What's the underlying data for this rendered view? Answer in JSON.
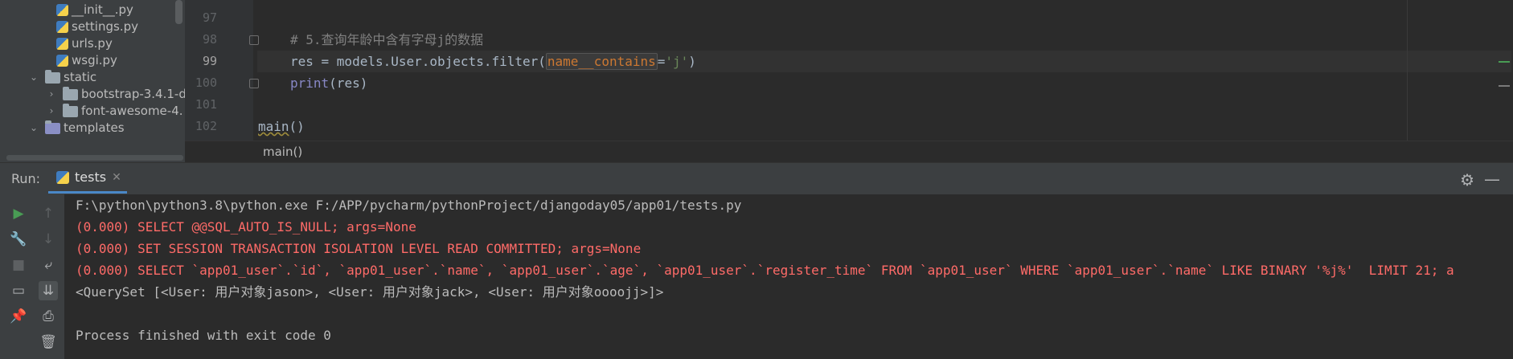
{
  "project_tree": {
    "items": [
      {
        "label": "__init__.py",
        "type": "python-file"
      },
      {
        "label": "settings.py",
        "type": "python-file"
      },
      {
        "label": "urls.py",
        "type": "python-file"
      },
      {
        "label": "wsgi.py",
        "type": "python-file"
      },
      {
        "label": "static",
        "type": "folder-expanded"
      },
      {
        "label": "bootstrap-3.4.1-d",
        "type": "folder-collapsed"
      },
      {
        "label": "font-awesome-4.",
        "type": "folder-collapsed"
      },
      {
        "label": "templates",
        "type": "folder-expanded"
      }
    ]
  },
  "editor": {
    "line_numbers": [
      "97",
      "98",
      "99",
      "100",
      "101",
      "102"
    ],
    "lines": {
      "l98_comment": "# 5.查询年龄中含有字母j的数据",
      "l99_prefix": "res = models.User.objects.filter(",
      "l99_param": "name__contains",
      "l99_eq": "=",
      "l99_str": "'j'",
      "l99_suffix": ")",
      "l100_print": "print",
      "l100_rest": "(res)",
      "l102_fn": "main",
      "l102_rest": "()"
    },
    "breadcrumb": "main()"
  },
  "run_panel": {
    "title": "Run:",
    "tab_label": "tests",
    "console_lines": [
      {
        "text": "F:\\python\\python3.8\\python.exe F:/APP/pycharm/pythonProject/djangoday05/app01/tests.py",
        "style": "normal"
      },
      {
        "text": "(0.000) SELECT @@SQL_AUTO_IS_NULL; args=None",
        "style": "error"
      },
      {
        "text": "(0.000) SET SESSION TRANSACTION ISOLATION LEVEL READ COMMITTED; args=None",
        "style": "error"
      },
      {
        "text": "(0.000) SELECT `app01_user`.`id`, `app01_user`.`name`, `app01_user`.`age`, `app01_user`.`register_time` FROM `app01_user` WHERE `app01_user`.`name` LIKE BINARY '%j%'  LIMIT 21; a",
        "style": "error"
      },
      {
        "text": "<QuerySet [<User: 用户对象jason>, <User: 用户对象jack>, <User: 用户对象oooojj>]>",
        "style": "normal"
      },
      {
        "text": "",
        "style": "normal"
      },
      {
        "text": "Process finished with exit code 0",
        "style": "normal"
      }
    ]
  },
  "colors": {
    "background": "#2b2b2b",
    "panel": "#3c3f41",
    "error_text": "#ff6b68",
    "string": "#6a8759",
    "keyword_param": "#cc7832",
    "comment": "#808080",
    "tab_accent": "#4a88c7",
    "run_green": "#499c54"
  }
}
